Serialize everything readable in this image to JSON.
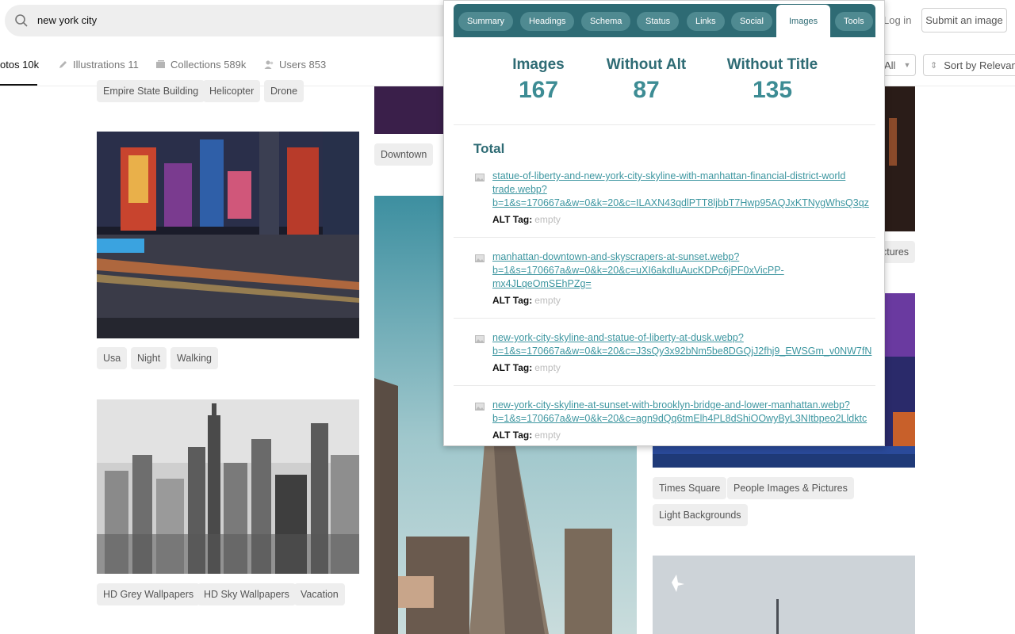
{
  "search": {
    "query": "new york city"
  },
  "header": {
    "login": "Log in",
    "submit": "Submit an image"
  },
  "tabs": [
    {
      "label": "otos 10k"
    },
    {
      "label": "Illustrations 11"
    },
    {
      "label": "Collections 589k"
    },
    {
      "label": "Users 853"
    }
  ],
  "filters": {
    "all": "All",
    "sort": "Sort by Relevance"
  },
  "tags": {
    "row1": [
      "Empire State Building",
      "Helicopter",
      "Drone"
    ],
    "mid1": [
      "Downtown"
    ],
    "right1": [
      "ctures"
    ],
    "row2": [
      "Usa",
      "Night",
      "Walking"
    ],
    "row3": [
      "HD Grey Wallpapers",
      "HD Sky Wallpapers",
      "Vacation"
    ],
    "right2": [
      "Times Square",
      "People Images & Pictures"
    ],
    "right3": [
      "Light Backgrounds"
    ]
  },
  "popup": {
    "nav": [
      "Summary",
      "Headings",
      "Schema",
      "Status",
      "Links",
      "Social",
      "Images",
      "Tools"
    ],
    "active_tab": "Images",
    "stats": [
      {
        "label": "Images",
        "value": "167"
      },
      {
        "label": "Without Alt",
        "value": "87"
      },
      {
        "label": "Without Title",
        "value": "135"
      }
    ],
    "total_title": "Total",
    "alt_label": "ALT Tag:",
    "images": [
      {
        "url": "statue-of-liberty-and-new-york-city-skyline-with-manhattan-financial-district-world\ntrade.webp?\nb=1&s=170667a&w=0&k=20&c=ILAXN43qdlPTT8ljbbT7Hwp95AQJxKTNygWhsQ3qz",
        "alt": "empty"
      },
      {
        "url": "manhattan-downtown-and-skyscrapers-at-sunset.webp?\nb=1&s=170667a&w=0&k=20&c=uXI6akdIuAucKDPc6jPF0xVicPP-\nmx4JLqeOmSEhPZg=",
        "alt": "empty"
      },
      {
        "url": "new-york-city-skyline-and-statue-of-liberty-at-dusk.webp?\nb=1&s=170667a&w=0&k=20&c=J3sQy3x92bNm5be8DGQjJ2fhj9_EWSGm_v0NW7fN",
        "alt": "empty"
      },
      {
        "url": "new-york-city-skyline-at-sunset-with-brooklyn-bridge-and-lower-manhattan.webp?\nb=1&s=170667a&w=0&k=20&c=agn9dQq6tmElh4PL8dShiOOwyByL3NItbpeo2Lldktc",
        "alt": "empty"
      }
    ]
  },
  "colors": {
    "accent": "#2e6b74",
    "link": "#3d96a0",
    "tag_bg": "#eeeeee"
  }
}
